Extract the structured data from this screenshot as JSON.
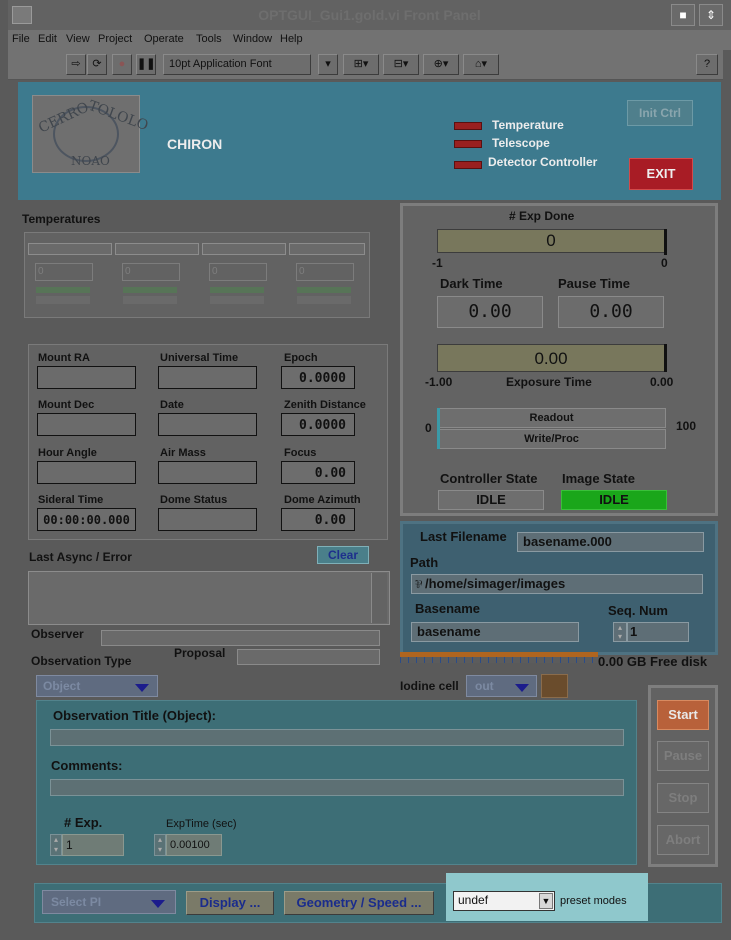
{
  "window": {
    "title": "OPTGUI_Gui1.gold.vi Front Panel"
  },
  "menu": [
    "File",
    "Edit",
    "View",
    "Project",
    "Operate",
    "Tools",
    "Window",
    "Help"
  ],
  "toolbar": {
    "font_select": "10pt Application Font"
  },
  "header": {
    "instrument": "CHIRON",
    "logo_text_left": "CERRO",
    "logo_text_right": "TOLOLO",
    "logo_text_bottom": "NOAO",
    "status_lights": [
      "Temperature",
      "Telescope",
      "Detector Controller"
    ],
    "init_button": "Init Ctrl",
    "exit_button": "EXIT"
  },
  "temperatures": {
    "label": "Temperatures",
    "values": [
      "0",
      "0",
      "0",
      "0"
    ]
  },
  "telescope": {
    "mount_ra_label": "Mount RA",
    "mount_ra": "",
    "universal_time_label": "Universal Time",
    "universal_time": "",
    "epoch_label": "Epoch",
    "epoch": "0.0000",
    "mount_dec_label": "Mount Dec",
    "mount_dec": "",
    "date_label": "Date",
    "date": "",
    "zenith_distance_label": "Zenith Distance",
    "zenith_distance": "0.0000",
    "hour_angle_label": "Hour Angle",
    "hour_angle": "",
    "air_mass_label": "Air Mass",
    "air_mass": "",
    "focus_label": "Focus",
    "focus": "0.00",
    "sideral_time_label": "Sideral Time",
    "sideral_time": "00:00:00.000",
    "dome_status_label": "Dome Status",
    "dome_status": "",
    "dome_azimuth_label": "Dome Azimuth",
    "dome_azimuth": "0.00"
  },
  "async": {
    "label": "Last Async / Error",
    "clear_button": "Clear",
    "text": ""
  },
  "observer": {
    "label": "Observer",
    "value": ""
  },
  "observation_type": {
    "label": "Observation Type",
    "selected": "Object"
  },
  "proposal": {
    "label": "Proposal",
    "value": ""
  },
  "exposure": {
    "exp_done_label": "# Exp Done",
    "exp_done_value": "0",
    "exp_done_scale_min": "-1",
    "exp_done_scale_max": "0",
    "dark_time_label": "Dark Time",
    "dark_time": "0.00",
    "pause_time_label": "Pause Time",
    "pause_time": "0.00",
    "exposure_time_value": "0.00",
    "exposure_time_label": "Exposure Time",
    "exposure_scale_min": "-1.00",
    "exposure_scale_max": "0.00",
    "readout_label": "Readout",
    "writeproc_label": "Write/Proc",
    "progress_min": "0",
    "progress_max": "100",
    "readout_progress": 0,
    "writeproc_progress": 0,
    "controller_state_label": "Controller State",
    "controller_state": "IDLE",
    "image_state_label": "Image State",
    "image_state": "IDLE"
  },
  "file": {
    "last_filename_label": "Last Filename",
    "last_filename": "basename.000",
    "path_label": "Path",
    "path": "/home/simager/images",
    "basename_label": "Basename",
    "basename": "basename",
    "seq_num_label": "Seq. Num",
    "seq_num": "1",
    "free_disk": "0.00 GB Free disk",
    "free_disk_fraction": 0
  },
  "iodine": {
    "label": "Iodine cell",
    "selected": "out"
  },
  "observation": {
    "title_label": "Observation Title (Object):",
    "title_value": "",
    "comments_label": "Comments:",
    "comments_value": "",
    "num_exp_label": "# Exp.",
    "num_exp": "1",
    "exptime_label": "ExpTime (sec)",
    "exptime": "0.00100"
  },
  "controls": {
    "start": "Start",
    "pause": "Pause",
    "stop": "Stop",
    "abort": "Abort"
  },
  "footer": {
    "select_pi": "Select PI",
    "display_button": "Display ...",
    "geometry_button": "Geometry / Speed ...",
    "preset_value": "undef",
    "preset_label": "preset modes"
  },
  "colors": {
    "header_bg": "#3d7a8e",
    "panel_bg": "#5a5a5a",
    "idle_green": "#1aa61a",
    "led_red": "#992020",
    "exit_red": "#a81c25",
    "start_orange": "#b8613a"
  }
}
